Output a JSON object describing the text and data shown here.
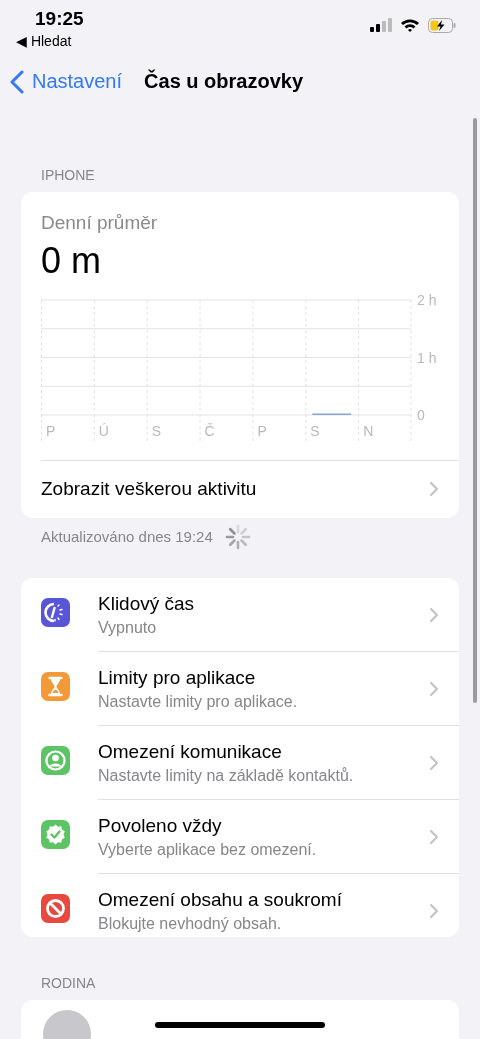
{
  "status_bar": {
    "time": "19:25",
    "back_app": "◀ Hledat"
  },
  "nav": {
    "back": "Nastavení",
    "title": "Čas u obrazovky"
  },
  "device_section": {
    "header": "IPHONE",
    "summary": {
      "label": "Denní průměr",
      "value": "0 m",
      "chart_data": {
        "type": "bar",
        "categories": [
          "P",
          "Ú",
          "S",
          "Č",
          "P",
          "S",
          "N"
        ],
        "values": [
          0,
          0,
          0,
          0,
          0,
          0.01,
          0
        ],
        "ylim": [
          0,
          2
        ],
        "yticks": [
          {
            "value": 0,
            "label": "0"
          },
          {
            "value": 1,
            "label": "1 h"
          },
          {
            "value": 2,
            "label": "2 h"
          }
        ]
      },
      "link": "Zobrazit veškerou aktivitu"
    },
    "footer": "Aktualizováno dnes 19:24"
  },
  "settings": [
    {
      "kind": "downtime",
      "color": "#5856d6",
      "title": "Klidový čas",
      "subtitle": "Vypnuto"
    },
    {
      "kind": "hourglass",
      "color": "#f19a37",
      "title": "Limity pro aplikace",
      "subtitle": "Nastavte limity pro aplikace."
    },
    {
      "kind": "contact",
      "color": "#5dc466",
      "title": "Omezení komunikace",
      "subtitle": "Nastavte limity na základě kontaktů."
    },
    {
      "kind": "seal",
      "color": "#5dc466",
      "title": "Povoleno vždy",
      "subtitle": "Vyberte aplikace bez omezení."
    },
    {
      "kind": "prohibited",
      "color": "#e9483f",
      "title": "Omezení obsahu a soukromí",
      "subtitle": "Blokujte nevhodný obsah."
    }
  ],
  "family_section": {
    "header": "RODINA"
  }
}
